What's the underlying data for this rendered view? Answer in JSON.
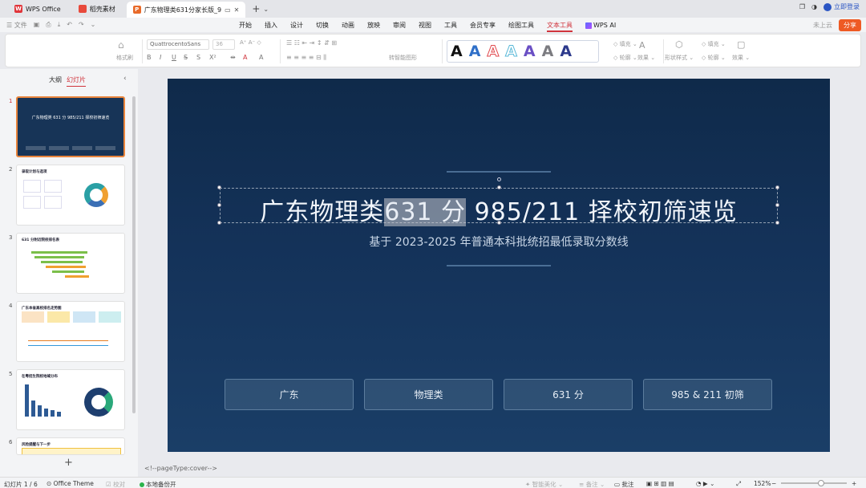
{
  "tabs": [
    {
      "label": "WPS Office",
      "icon": "wps-logo-icon"
    },
    {
      "label": "稻壳素材",
      "icon": "docer-logo-icon"
    },
    {
      "label": "广东物理类631分家长版_9",
      "icon": "ppt-file-icon",
      "active": true
    }
  ],
  "window": {
    "login_label": "立即登录"
  },
  "quick_access": {
    "file_label": "文件"
  },
  "menus": [
    "开始",
    "插入",
    "设计",
    "切换",
    "动画",
    "放映",
    "审阅",
    "视图",
    "工具",
    "会员专享",
    "绘图工具",
    "文本工具",
    "WPS AI"
  ],
  "menu_active": "文本工具",
  "menu_right": {
    "cloud_label": "未上云",
    "share_label": "分享"
  },
  "ribbon": {
    "format_painter": "格式刷",
    "font_name": "QuattrocentoSans",
    "font_size": "36",
    "convert_label": "转智能图形",
    "fill_label": "填充",
    "outline_label": "轮廓",
    "effect_label": "效果",
    "shape_style_label": "形状样式",
    "shape_fill_label": "填充",
    "shape_outline_label": "轮廓",
    "shape_effect_label": "效果",
    "art_colors": [
      "#111111",
      "#2f6fc8",
      "#e0474c",
      "#58b8d8",
      "#6a4fc4",
      "#7b7b80",
      "#2d3a8c"
    ]
  },
  "left_panel": {
    "tab_outline": "大纲",
    "tab_slides": "幻灯片",
    "thumbs": [
      {
        "num": "1",
        "title": "广东物理类 631 分 985/211 择校初筛速览"
      },
      {
        "num": "2",
        "title": "录取计划与选项"
      },
      {
        "num": "3",
        "title": "631 分附近院校排名表"
      },
      {
        "num": "4",
        "title": "广东本省高校排名走势图"
      },
      {
        "num": "5",
        "title": "在粤招生院校地域分布"
      },
      {
        "num": "6",
        "title": "风险提醒与下一步"
      }
    ]
  },
  "slide": {
    "title_before": "广东物理类",
    "title_highlight": "631 分",
    "title_after": " 985/211 择校初筛速览",
    "subtitle": "基于 2023-2025 年普通本科批统招最低录取分数线",
    "tags": [
      "广东",
      "物理类",
      "631 分",
      "985 & 211 初筛"
    ]
  },
  "notes": "<!--pageType:cover-->",
  "status": {
    "slide_info": "幻灯片 1 / 6",
    "theme": "Office Theme",
    "proofread": "校对",
    "backup": "本地备份开",
    "smart_beautify": "智能美化",
    "notes_label": "备注",
    "comments_label": "批注",
    "zoom": "152%"
  }
}
